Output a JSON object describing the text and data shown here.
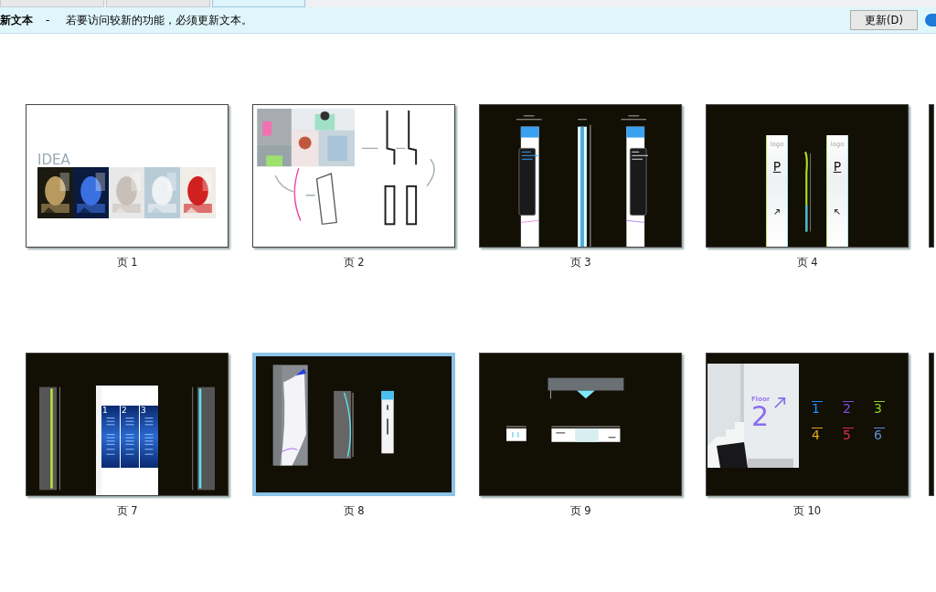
{
  "tab_strip": {
    "tabs": [
      {
        "selected": false
      },
      {
        "selected": false
      },
      {
        "selected": true
      }
    ]
  },
  "notification": {
    "title": "新文本",
    "separator": "-",
    "message": "若要访问较新的功能，必须更新文本。",
    "button": "更新(D)"
  },
  "rows": [
    {
      "edge_page": true,
      "pages": [
        {
          "label": "页 1",
          "selected": false,
          "kind": "idea",
          "heading": "IDEA"
        },
        {
          "label": "页 2",
          "selected": false,
          "kind": "sketch"
        },
        {
          "label": "页 3",
          "selected": false,
          "kind": "pillars"
        },
        {
          "label": "页 4",
          "selected": false,
          "kind": "parking",
          "signs": [
            {
              "logo": "logo",
              "letter": "P"
            },
            {
              "logo": "logo",
              "letter": "P"
            }
          ]
        }
      ]
    },
    {
      "edge_page": true,
      "pages": [
        {
          "label": "页 7",
          "selected": false,
          "kind": "directory",
          "panels": [
            "1",
            "2",
            "3"
          ]
        },
        {
          "label": "页 8",
          "selected": true,
          "kind": "curved"
        },
        {
          "label": "页 9",
          "selected": false,
          "kind": "hanging"
        },
        {
          "label": "页 10",
          "selected": false,
          "kind": "floor",
          "floor_label": "Floor",
          "floor_number": "2",
          "numbers": [
            {
              "text": "1",
              "color": "#1e90ff"
            },
            {
              "text": "2",
              "color": "#7b4fe0"
            },
            {
              "text": "3",
              "color": "#8ad61e"
            },
            {
              "text": "4",
              "color": "#e0a81e"
            },
            {
              "text": "5",
              "color": "#d8304a"
            },
            {
              "text": "6",
              "color": "#5f8fd0"
            }
          ]
        }
      ]
    }
  ]
}
